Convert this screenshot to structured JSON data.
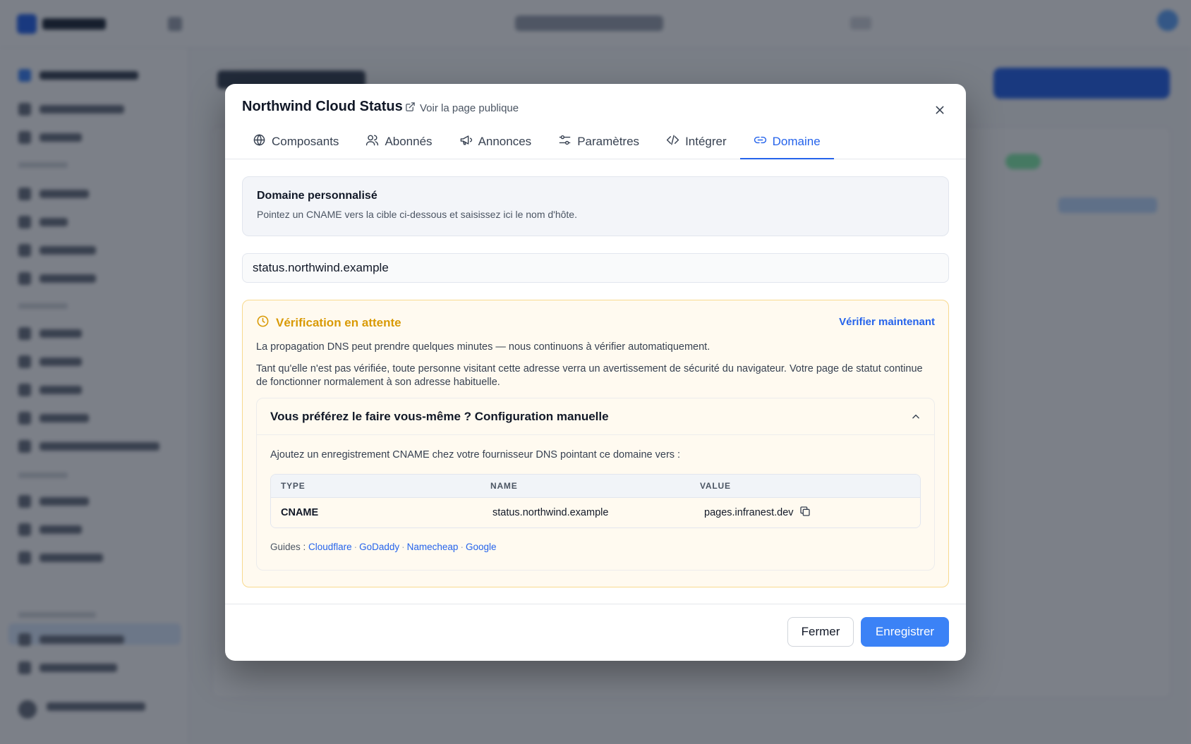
{
  "modal": {
    "title": "Northwind Cloud Status",
    "public_link": "Voir la page publique",
    "tabs": [
      {
        "label": "Composants",
        "icon": "globe-icon"
      },
      {
        "label": "Abonnés",
        "icon": "users-icon"
      },
      {
        "label": "Annonces",
        "icon": "megaphone-icon"
      },
      {
        "label": "Paramètres",
        "icon": "sliders-icon"
      },
      {
        "label": "Intégrer",
        "icon": "code-icon"
      },
      {
        "label": "Domaine",
        "icon": "link-icon",
        "active": true
      }
    ],
    "info": {
      "title": "Domaine personnalisé",
      "description": "Pointez un CNAME vers la cible ci-dessous et saisissez ici le nom d'hôte."
    },
    "hostname_value": "status.northwind.example",
    "verification": {
      "status": "Vérification en attente",
      "verify_action": "Vérifier maintenant",
      "paragraph_1": "La propagation DNS peut prendre quelques minutes — nous continuons à vérifier automatiquement.",
      "paragraph_2": "Tant qu'elle n'est pas vérifiée, toute personne visitant cette adresse verra un avertissement de sécurité du navigateur. Votre page de statut continue de fonctionner normalement à son adresse habituelle."
    },
    "manual": {
      "title": "Vous préférez le faire vous-même ? Configuration manuelle",
      "description": "Ajoutez un enregistrement CNAME chez votre fournisseur DNS pointant ce domaine vers :",
      "columns": [
        "TYPE",
        "NAME",
        "VALUE"
      ],
      "record": {
        "type": "CNAME",
        "name": "status.northwind.example",
        "value": "pages.infranest.dev"
      },
      "guides_label": "Guides :",
      "guides": [
        "Cloudflare",
        "GoDaddy",
        "Namecheap",
        "Google"
      ],
      "guide_separator": "·"
    },
    "footer": {
      "close_label": "Fermer",
      "save_label": "Enregistrer"
    }
  },
  "colors": {
    "accent": "#3b82f6",
    "warning": "#d99a06",
    "warning_bg": "#fffaf0",
    "warning_border": "#f8d98e"
  }
}
